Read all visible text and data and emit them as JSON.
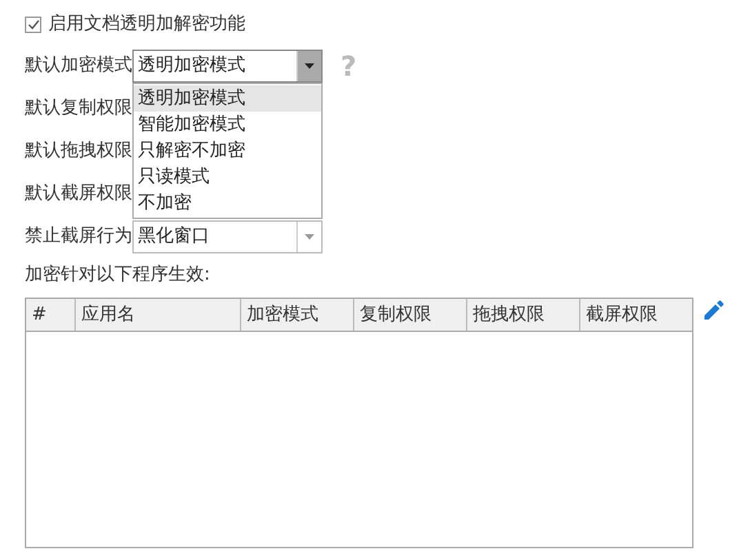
{
  "enable_checkbox": {
    "label": "启用文档透明加解密功能",
    "checked": true
  },
  "fields": [
    {
      "label": "默认加密模式",
      "value": "透明加密模式",
      "expanded": true,
      "help": "?",
      "options": [
        {
          "label": "透明加密模式",
          "selected": true
        },
        {
          "label": "智能加密模式",
          "selected": false
        },
        {
          "label": "只解密不加密",
          "selected": false
        },
        {
          "label": "只读模式",
          "selected": false
        },
        {
          "label": "不加密",
          "selected": false
        }
      ]
    },
    {
      "label": "默认复制权限"
    },
    {
      "label": "默认拖拽权限"
    },
    {
      "label": "默认截屏权限"
    },
    {
      "label": "禁止截屏行为",
      "value": "黑化窗口",
      "expanded": false
    }
  ],
  "table_caption": "加密针对以下程序生效:",
  "table": {
    "columns": [
      "#",
      "应用名",
      "加密模式",
      "复制权限",
      "拖拽权限",
      "截屏权限"
    ]
  }
}
